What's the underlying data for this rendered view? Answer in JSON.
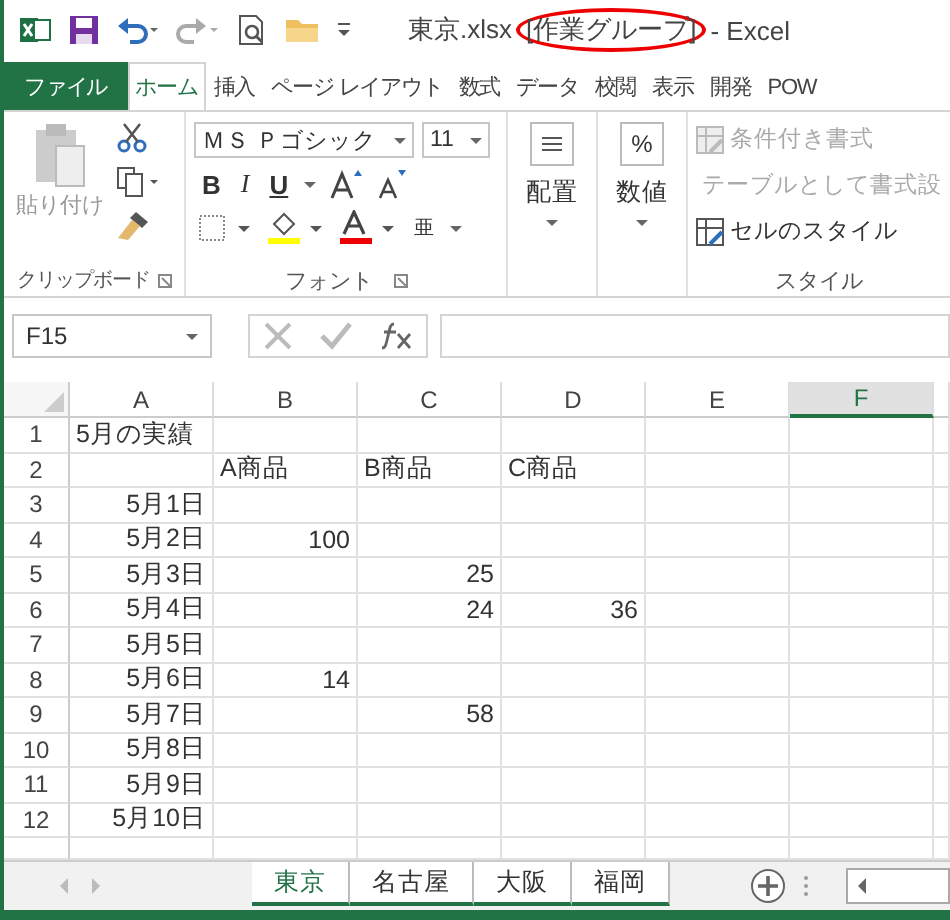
{
  "window": {
    "title_file": "東京.xlsx",
    "title_group": "[作業グループ]",
    "title_app": " - Excel"
  },
  "ribbon_tabs": [
    {
      "label": "ファイル",
      "kind": "file",
      "selected": false
    },
    {
      "label": "ホーム",
      "kind": "tab",
      "selected": true
    },
    {
      "label": "挿入",
      "kind": "tab",
      "selected": false
    },
    {
      "label": "ページ レイアウト",
      "kind": "tab",
      "selected": false
    },
    {
      "label": "数式",
      "kind": "tab",
      "selected": false
    },
    {
      "label": "データ",
      "kind": "tab",
      "selected": false
    },
    {
      "label": "校閲",
      "kind": "tab",
      "selected": false
    },
    {
      "label": "表示",
      "kind": "tab",
      "selected": false
    },
    {
      "label": "開発",
      "kind": "tab",
      "selected": false
    },
    {
      "label": "POW",
      "kind": "tab",
      "selected": false
    }
  ],
  "clipboard": {
    "paste": "貼り付け",
    "paste_disabled": true,
    "group_label": "クリップボード"
  },
  "font": {
    "name": "ＭＳ Ｐゴシック",
    "size": "11",
    "bold": "B",
    "italic": "I",
    "underline": "U",
    "phonetic": "亜",
    "group_label": "フォント"
  },
  "alignment": {
    "label": "配置"
  },
  "number": {
    "symbol": "%",
    "label": "数値"
  },
  "styles": {
    "items": [
      {
        "label": "条件付き書式",
        "disabled": true
      },
      {
        "label": "テーブルとして書式設",
        "disabled": true
      },
      {
        "label": "セルのスタイル",
        "disabled": false
      }
    ],
    "group_label": "スタイル"
  },
  "formula_bar": {
    "name_box": "F15"
  },
  "columns": [
    {
      "label": "A",
      "selected": false
    },
    {
      "label": "B",
      "selected": false
    },
    {
      "label": "C",
      "selected": false
    },
    {
      "label": "D",
      "selected": false
    },
    {
      "label": "E",
      "selected": false
    },
    {
      "label": "F",
      "selected": true
    }
  ],
  "rows": [
    {
      "number": "1",
      "cells": [
        {
          "text": "5月の実績",
          "kind": "text"
        }
      ]
    },
    {
      "number": "2",
      "cells": [
        {
          "kind": "empty"
        },
        {
          "text": "A商品",
          "kind": "text"
        },
        {
          "text": "B商品",
          "kind": "text"
        },
        {
          "text": "C商品",
          "kind": "text"
        }
      ]
    },
    {
      "number": "3",
      "cells": [
        {
          "text": "5月1日",
          "kind": "date"
        }
      ]
    },
    {
      "number": "4",
      "cells": [
        {
          "text": "5月2日",
          "kind": "date"
        },
        {
          "text": "100",
          "kind": "number"
        }
      ]
    },
    {
      "number": "5",
      "cells": [
        {
          "text": "5月3日",
          "kind": "date"
        },
        {
          "kind": "empty"
        },
        {
          "text": "25",
          "kind": "number"
        }
      ]
    },
    {
      "number": "6",
      "cells": [
        {
          "text": "5月4日",
          "kind": "date"
        },
        {
          "kind": "empty"
        },
        {
          "text": "24",
          "kind": "number"
        },
        {
          "text": "36",
          "kind": "number"
        }
      ]
    },
    {
      "number": "7",
      "cells": [
        {
          "text": "5月5日",
          "kind": "date"
        }
      ]
    },
    {
      "number": "8",
      "cells": [
        {
          "text": "5月6日",
          "kind": "date"
        },
        {
          "text": "14",
          "kind": "number"
        }
      ]
    },
    {
      "number": "9",
      "cells": [
        {
          "text": "5月7日",
          "kind": "date"
        },
        {
          "kind": "empty"
        },
        {
          "text": "58",
          "kind": "number"
        }
      ]
    },
    {
      "number": "10",
      "cells": [
        {
          "text": "5月8日",
          "kind": "date"
        }
      ]
    },
    {
      "number": "11",
      "cells": [
        {
          "text": "5月9日",
          "kind": "date"
        }
      ]
    },
    {
      "number": "12",
      "cells": [
        {
          "text": "5月10日",
          "kind": "date"
        }
      ]
    }
  ],
  "sheet_tabs": [
    {
      "label": "東京",
      "selected": true,
      "grouped": true
    },
    {
      "label": "名古屋",
      "selected": false,
      "grouped": true
    },
    {
      "label": "大阪",
      "selected": false,
      "grouped": true
    },
    {
      "label": "福岡",
      "selected": false,
      "grouped": true
    }
  ]
}
